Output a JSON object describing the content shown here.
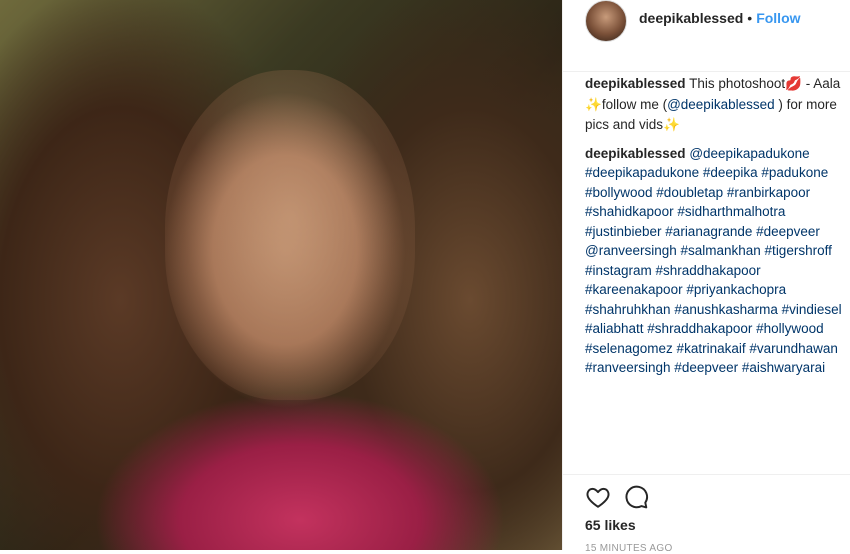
{
  "post": {
    "username": "deepikablessed",
    "separator": "•",
    "follow_label": "Follow",
    "image_alt": "photo"
  },
  "comments": [
    {
      "username": "deepikablessed",
      "lines": [
        [
          "This photoshoot",
          "💋",
          " - Aala"
        ],
        [
          "✨",
          "follow me (",
          "@deepikablessed",
          " ) for more"
        ],
        [
          "pics and vids",
          "✨"
        ]
      ]
    },
    {
      "username": "deepikablessed",
      "first": "@deepikapadukone",
      "tag_lines": [
        "#deepikapadukone #deepika #padukone",
        "#bollywood #doubletap #ranbirkapoor",
        "#shahidkapoor #sidharthmalhotra",
        "#justinbieber #arianagrande #deepveer",
        "@ranveersingh #salmankhan #tigershroff",
        "#instagram #shraddhakapoor",
        "#kareenakapoor #priyankachopra",
        "#shahruhkhan #anushkasharma #vindiesel",
        "#aliabhatt #shraddhakapoor #hollywood",
        "#selenagomez #katrinakaif #varundhawan",
        "#ranveersingh #deepveer #aishwaryarai"
      ]
    }
  ],
  "actions": {
    "like_icon": "heart-icon",
    "comment_icon": "comment-icon"
  },
  "likes_text": "65 likes",
  "timestamp": "15 MINUTES AGO"
}
